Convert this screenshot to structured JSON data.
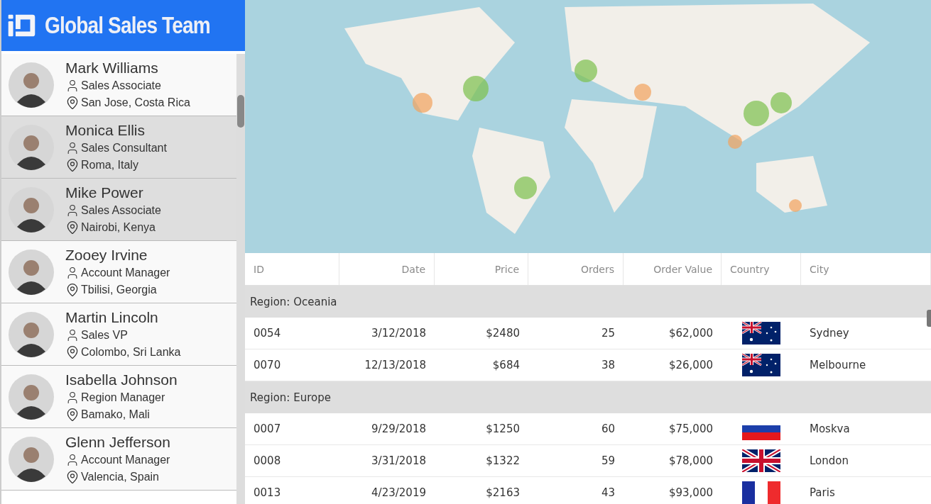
{
  "header": {
    "title": "Global Sales Team"
  },
  "people": [
    {
      "name": "Mark Williams",
      "role": "Sales Associate",
      "location": "San Jose, Costa Rica",
      "selected": false
    },
    {
      "name": "Monica Ellis",
      "role": "Sales Consultant",
      "location": "Roma, Italy",
      "selected": true
    },
    {
      "name": "Mike Power",
      "role": "Sales Associate",
      "location": "Nairobi, Kenya",
      "selected": true
    },
    {
      "name": "Zooey Irvine",
      "role": "Account Manager",
      "location": "Tbilisi, Georgia",
      "selected": false
    },
    {
      "name": "Martin Lincoln",
      "role": "Sales VP",
      "location": "Colombo, Sri Lanka",
      "selected": false
    },
    {
      "name": "Isabella Johnson",
      "role": "Region Manager",
      "location": "Bamako, Mali",
      "selected": false
    },
    {
      "name": "Glenn Jefferson",
      "role": "Account Manager",
      "location": "Valencia, Spain",
      "selected": false
    }
  ],
  "table": {
    "columns": [
      {
        "label": "ID",
        "kind": "text"
      },
      {
        "label": "Date",
        "kind": "number"
      },
      {
        "label": "Price",
        "kind": "number"
      },
      {
        "label": "Orders",
        "kind": "number"
      },
      {
        "label": "Order Value",
        "kind": "number"
      },
      {
        "label": "Country",
        "kind": "flag"
      },
      {
        "label": "City",
        "kind": "text"
      }
    ],
    "groups": [
      {
        "label": "Region: Oceania",
        "rows": [
          {
            "cells": [
              "0054",
              "3/12/2018",
              "$2480",
              "25",
              "$62,000",
              "Sydney"
            ],
            "kind": "au"
          },
          {
            "cells": [
              "0070",
              "12/13/2018",
              "$684",
              "38",
              "$26,000",
              "Melbourne"
            ],
            "kind": "au"
          }
        ]
      },
      {
        "label": "Region: Europe",
        "rows": [
          {
            "cells": [
              "0007",
              "9/29/2018",
              "$1250",
              "60",
              "$75,000",
              "Moskva"
            ],
            "kind": "ru"
          },
          {
            "cells": [
              "0008",
              "3/31/2018",
              "$1322",
              "59",
              "$78,000",
              "London"
            ],
            "kind": "gb"
          },
          {
            "cells": [
              "0013",
              "4/23/2019",
              "$2163",
              "43",
              "$93,000",
              "Paris"
            ],
            "kind": "fr"
          }
        ]
      }
    ]
  }
}
